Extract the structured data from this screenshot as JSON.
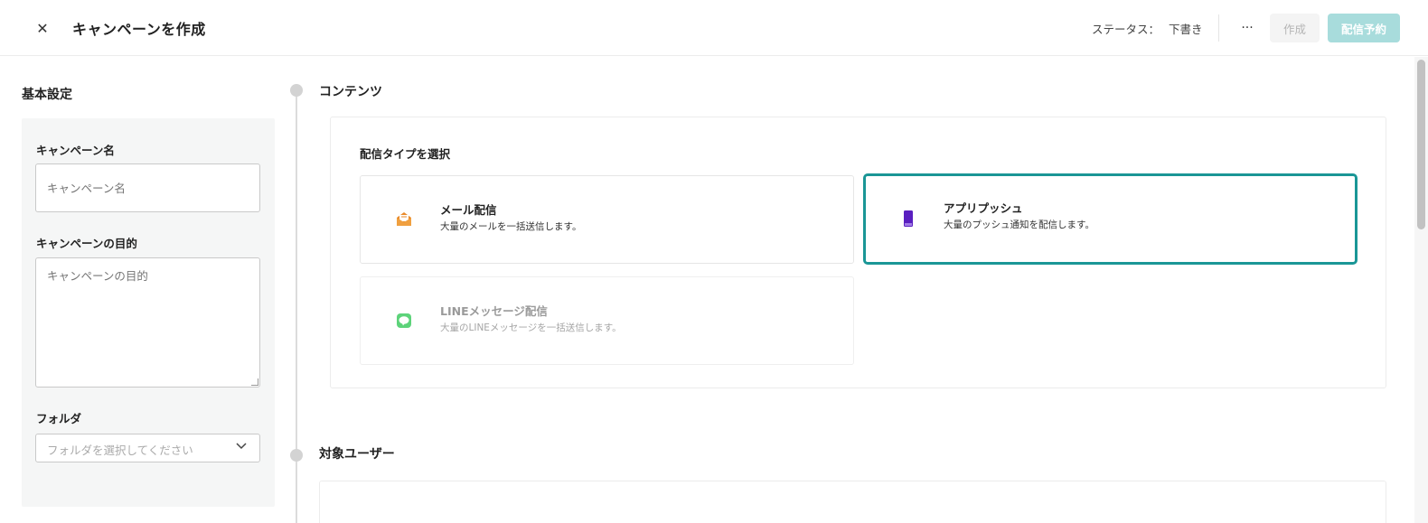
{
  "header": {
    "close_icon": "close-icon",
    "title": "キャンペーンを作成",
    "status_label": "ステータス：",
    "status_value": "下書き",
    "more_label": "···",
    "create_label": "作成",
    "schedule_label": "配信予約"
  },
  "basic_settings": {
    "heading": "基本設定",
    "campaign_name": {
      "label": "キャンペーン名",
      "placeholder": "キャンペーン名",
      "value": ""
    },
    "campaign_purpose": {
      "label": "キャンペーンの目的",
      "placeholder": "キャンペーンの目的",
      "value": ""
    },
    "folder": {
      "label": "フォルダ",
      "placeholder": "フォルダを選択してください",
      "chevron_icon": "chevron-down-icon"
    }
  },
  "content": {
    "heading": "コンテンツ",
    "subheading": "配信タイプを選択",
    "types": [
      {
        "title": "メール配信",
        "description": "大量のメールを一括送信します。",
        "icon": "envelope-icon",
        "selected": false,
        "disabled": false
      },
      {
        "title": "アプリプッシュ",
        "description": "大量のプッシュ通知を配信します。",
        "icon": "smartphone-icon",
        "selected": true,
        "disabled": false
      },
      {
        "title": "LINEメッセージ配信",
        "description": "大量のLINEメッセージを一括送信します。",
        "icon": "line-chat-icon",
        "selected": false,
        "disabled": true
      }
    ]
  },
  "target_users": {
    "heading": "対象ユーザー"
  },
  "colors": {
    "accent": "#1a9696",
    "schedule_button_bg": "#a8dcdc",
    "email_icon": "#e98a2a",
    "push_icon": "#5a1fc0",
    "line_icon": "#5dd37a"
  }
}
